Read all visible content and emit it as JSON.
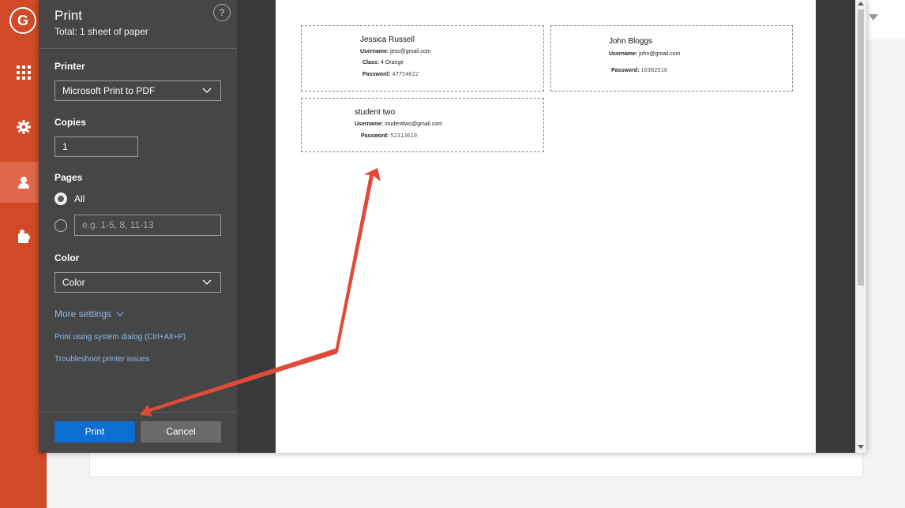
{
  "app": {
    "logo_letter": "G"
  },
  "dialog": {
    "title": "Print",
    "subtitle": "Total: 1 sheet of paper",
    "help_icon": "?",
    "printer": {
      "label": "Printer",
      "value": "Microsoft Print to PDF"
    },
    "copies": {
      "label": "Copies",
      "value": "1"
    },
    "pages": {
      "label": "Pages",
      "option_all": "All",
      "custom_placeholder": "e.g. 1-5, 8, 11-13"
    },
    "color": {
      "label": "Color",
      "value": "Color"
    },
    "more_settings": "More settings",
    "system_dialog": "Print using system dialog (Ctrl+Alt+P)",
    "troubleshoot": "Troubleshoot printer issues",
    "print_button": "Print",
    "cancel_button": "Cancel"
  },
  "preview": {
    "cards": [
      {
        "name": "Jessica Russell",
        "username_label": "Username:",
        "username": "jess@gmail.com",
        "class_label": "Class:",
        "class": "4 Orange",
        "password_label": "Password:",
        "password": "47754622"
      },
      {
        "name": "John Bloggs",
        "username_label": "Username:",
        "username": "john@gmail.com",
        "password_label": "Password:",
        "password": "10382516"
      },
      {
        "name": "student two",
        "username_label": "Username:",
        "username": "studenttwo@gmail.com",
        "password_label": "Password:",
        "password": "52313610"
      }
    ]
  },
  "colors": {
    "brand": "#d04a27",
    "panel": "#464646",
    "primary_button": "#0b6ed0",
    "link": "#8fb8ee",
    "annotation_arrow": "#e04a38"
  }
}
